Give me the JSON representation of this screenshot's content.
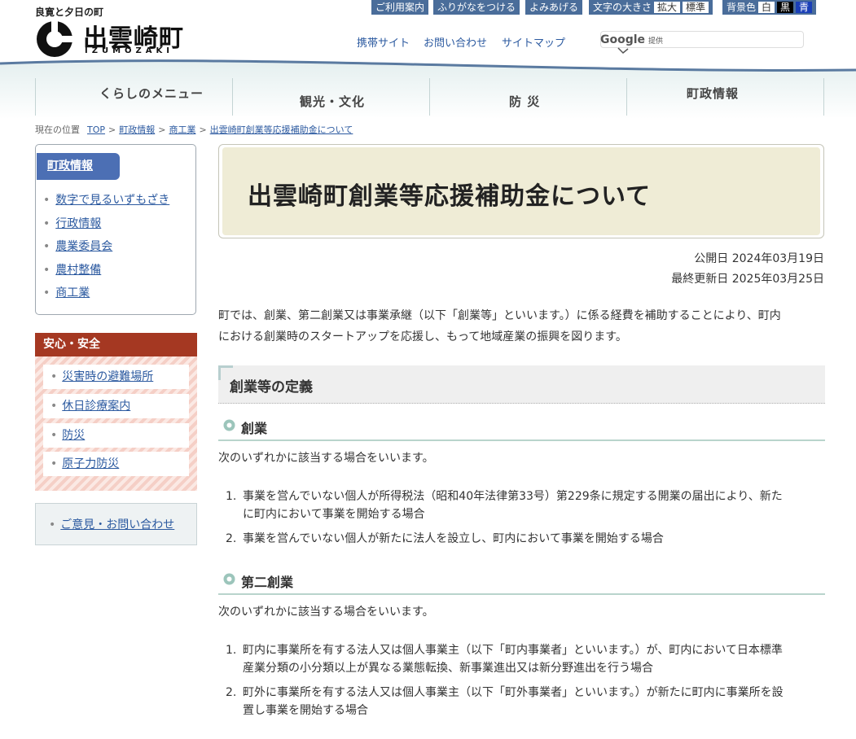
{
  "header": {
    "tagline": "良寛と夕日の町",
    "town_name": "出雲崎町",
    "town_roman": "IZUMOZAKI",
    "tools": {
      "guide": "ご利用案内",
      "furigana": "ふりがなをつける",
      "read_aloud": "よみあげる",
      "font_size_label": "文字の大きさ",
      "font_size_large": "拡大",
      "font_size_standard": "標準",
      "bg_color_label": "背景色",
      "bg_white": "白",
      "bg_black": "黒",
      "bg_blue": "青"
    },
    "links": {
      "mobile": "携帯サイト",
      "contact": "お問い合わせ",
      "sitemap": "サイトマップ"
    },
    "search": {
      "provider": "Google",
      "provider_suffix": "提供",
      "value": ""
    }
  },
  "nav": {
    "items": [
      "くらしのメニュー",
      "観光・文化",
      "防 災",
      "町政情報"
    ]
  },
  "breadcrumb": {
    "label": "現在の位置",
    "items": [
      "TOP",
      "町政情報",
      "商工業",
      "出雲崎町創業等応援補助金について"
    ],
    "separator": ">"
  },
  "sidebar": {
    "section1": {
      "heading": "町政情報",
      "items": [
        "数字で見るいずもざき",
        "行政情報",
        "農業委員会",
        "農村整備",
        "商工業"
      ]
    },
    "section2": {
      "heading": "安心・安全",
      "items": [
        "災害時の避難場所",
        "休日診療案内",
        "防災",
        "原子力防災"
      ]
    },
    "contact": "ご意見・お問い合わせ"
  },
  "main": {
    "title": "出雲崎町創業等応援補助金について",
    "published": "公開日 2024年03月19日",
    "updated": "最終更新日 2025年03月25日",
    "intro_line1": "町では、創業、第二創業又は事業承継（以下「創業等」といいます。）に係る経費を補助することにより、町内",
    "intro_line2": "における創業時のスタートアップを応援し、もって地域産業の振興を図ります。",
    "section_heading": "創業等の定義",
    "sub1": {
      "heading": "創業",
      "lead": "次のいずれかに該当する場合をいいます。",
      "items": [
        {
          "num": "1.",
          "line1": "事業を営んでいない個人が所得税法（昭和40年法律第33号）第229条に規定する開業の届出により、新た",
          "line2": "に町内において事業を開始する場合"
        },
        {
          "num": "2.",
          "line1": "事業を営んでいない個人が新たに法人を設立し、町内において事業を開始する場合",
          "line2": ""
        }
      ]
    },
    "sub2": {
      "heading": "第二創業",
      "lead": "次のいずれかに該当する場合をいいます。",
      "items": [
        {
          "num": "1.",
          "line1": "町内に事業所を有する法人又は個人事業主（以下「町内事業者」といいます。）が、町内において日本標準",
          "line2": "産業分類の小分類以上が異なる業態転換、新事業進出又は新分野進出を行う場合"
        },
        {
          "num": "2.",
          "line1": "町外に事業所を有する法人又は個人事業主（以下「町外事業者」といいます。）が新たに町内に事業所を設",
          "line2": "置し事業を開始する場合"
        }
      ]
    }
  },
  "colors": {
    "accent_blue": "#4c6fb4",
    "safety_red": "#a53822",
    "title_bg": "#efecd6",
    "h3_line": "#b8d4cc"
  }
}
